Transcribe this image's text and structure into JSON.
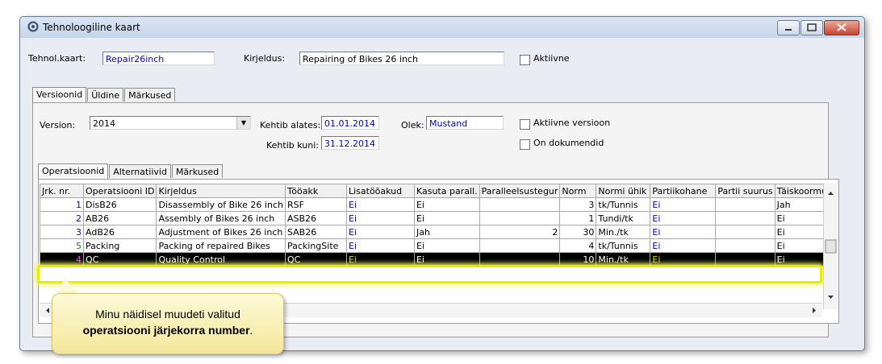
{
  "window": {
    "title": "Tehnoloogiline kaart"
  },
  "header": {
    "tehnol_label": "Tehnol.kaart:",
    "tehnol_value": "Repair26inch",
    "kirjeldus_label": "Kirjeldus:",
    "kirjeldus_value": "Repairing of Bikes 26 inch",
    "aktiivne_label": "Aktiivne"
  },
  "outer_tabs": [
    "Versioonid",
    "Üldine",
    "Märkused"
  ],
  "version": {
    "version_label": "Version:",
    "version_value": "2014",
    "kehtib_alates_label": "Kehtib alates:",
    "kehtib_alates_value": "01.01.2014",
    "kehtib_kuni_label": "Kehtib kuni:",
    "kehtib_kuni_value": "31.12.2014",
    "olek_label": "Olek:",
    "olek_value": "Mustand",
    "aktiivne_versioon_label": "Aktiivne versioon",
    "on_dokumendid_label": "On dokumendid"
  },
  "inner_tabs": [
    "Operatsioonid",
    "Alternatiivid",
    "Märkused"
  ],
  "grid": {
    "columns": [
      "Jrk. nr.",
      "Operatsiooni ID",
      "Kirjeldus",
      "Tööakk",
      "Lisatööakud",
      "Kasuta parall.",
      "Paralleelsustegur",
      "Norm",
      "Normi ühik",
      "Partiikohane",
      "Partii suurus",
      "Täiskoormus"
    ],
    "rows": [
      [
        "1",
        "DisB26",
        "Disassembly of Bike 26 inch",
        "RSF",
        "Ei",
        "Ei",
        "",
        "3",
        "tk/Tunnis",
        "Ei",
        "",
        "Jah"
      ],
      [
        "2",
        "AB26",
        "Assembly of Bikes 26 inch",
        "ASB26",
        "Ei",
        "Ei",
        "",
        "1",
        "Tundi/tk",
        "Ei",
        "",
        "Ei"
      ],
      [
        "3",
        "AdB26",
        "Adjustment of Bikes 26 inch",
        "SAB26",
        "Ei",
        "Jah",
        "2",
        "30",
        "Min./tk",
        "Ei",
        "",
        "Ei"
      ],
      [
        "5",
        "Packing",
        "Packing of repaired Bikes",
        "PackingSite",
        "Ei",
        "Ei",
        "",
        "4",
        "tk/Tunnis",
        "Ei",
        "",
        "Ei"
      ],
      [
        "4",
        "QC",
        "Quality Control",
        "QC",
        "Ei",
        "Ei",
        "",
        "10",
        "Min./tk",
        "Ei",
        "",
        "Ei"
      ]
    ],
    "selected_row": 4
  },
  "callout": {
    "line1": "Minu näidisel muudeti valitud",
    "line2_bold": "operatsiooni järjekorra number",
    "line2_end": "."
  },
  "colors": {
    "highlight": "#e5f000",
    "link_blue": "#0000cc"
  }
}
